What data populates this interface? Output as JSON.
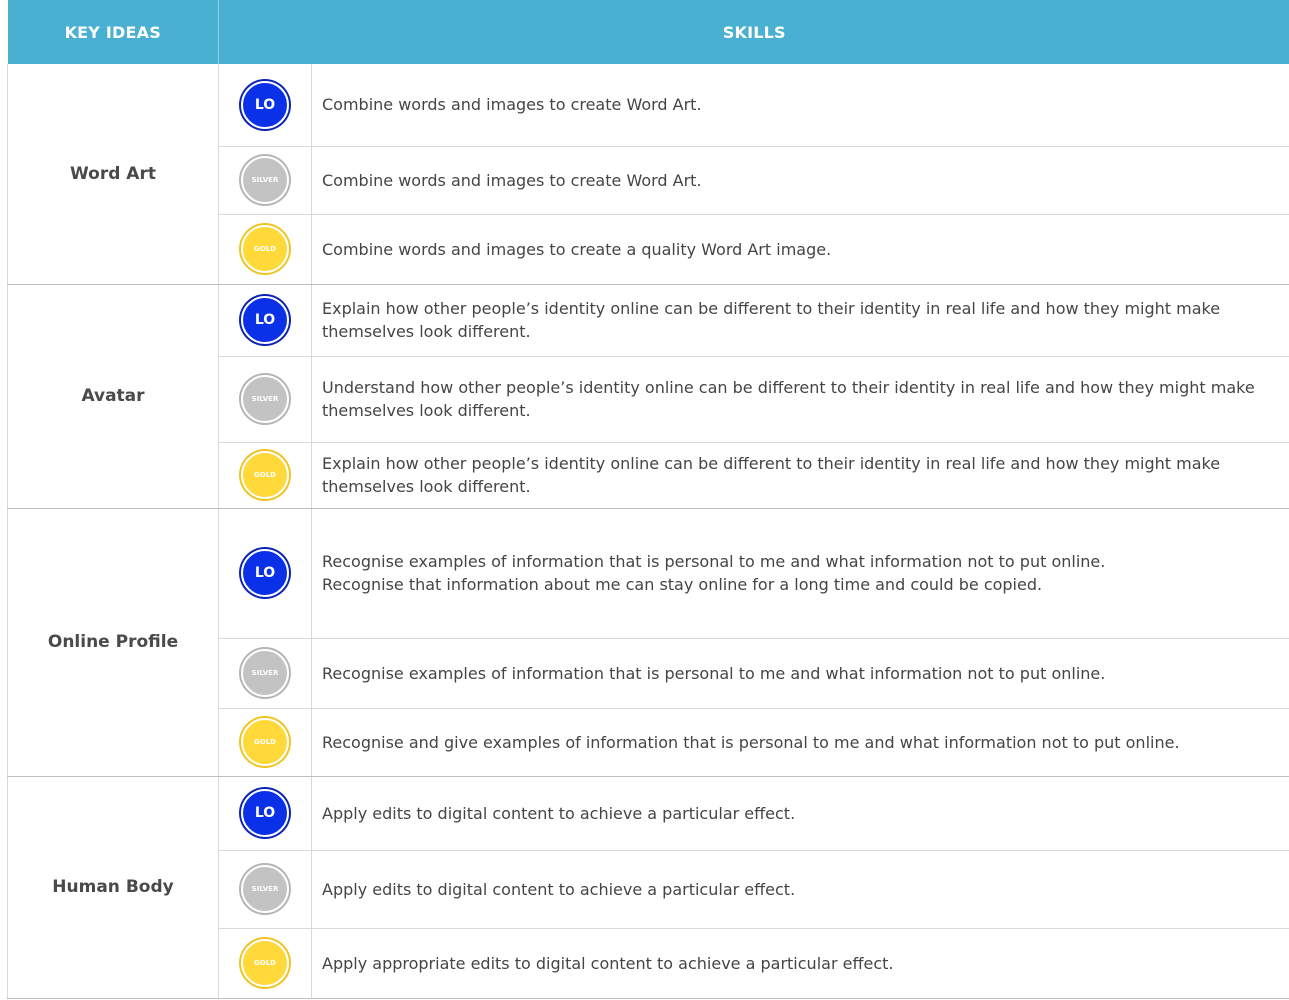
{
  "header": {
    "key_ideas": "KEY IDEAS",
    "skills": "SKILLS"
  },
  "badges": {
    "lo": "LO",
    "silver": "SILVER",
    "gold": "GOLD"
  },
  "colors": {
    "header_bg": "#4ab0d2",
    "lo": "#0a31e8",
    "silver": "#c3c3c3",
    "gold": "#ffd83a"
  },
  "groups": [
    {
      "key_idea": "Word Art",
      "rows": [
        {
          "level": "lo",
          "text": "Combine words and images to create Word Art."
        },
        {
          "level": "silver",
          "text": "Combine words and images to create Word Art."
        },
        {
          "level": "gold",
          "text": "Combine words and images to create a quality Word Art image."
        }
      ]
    },
    {
      "key_idea": "Avatar",
      "rows": [
        {
          "level": "lo",
          "text": "Explain how other people’s identity online can be different to their identity in real life and how they might make themselves look different."
        },
        {
          "level": "silver",
          "text": "Understand how other people’s identity online can be different to their identity in real life and how they might make themselves look different."
        },
        {
          "level": "gold",
          "text": "Explain how other people’s identity online can be different to their identity in real life and how they might make themselves look different."
        }
      ]
    },
    {
      "key_idea": "Online Profile",
      "rows": [
        {
          "level": "lo",
          "text": "Recognise examples of information that is personal to me and what information not to put online.\nRecognise that information about me can stay online for a long time and could be copied."
        },
        {
          "level": "silver",
          "text": "Recognise examples of information that is personal to me and what information not to put online."
        },
        {
          "level": "gold",
          "text": "Recognise and give examples of information that is personal to me and what information not to put online."
        }
      ]
    },
    {
      "key_idea": "Human Body",
      "rows": [
        {
          "level": "lo",
          "text": "Apply edits to digital content to achieve a particular effect."
        },
        {
          "level": "silver",
          "text": "Apply edits to digital content to achieve a particular effect."
        },
        {
          "level": "gold",
          "text": "Apply appropriate edits to digital content to achieve a particular effect."
        }
      ]
    }
  ]
}
